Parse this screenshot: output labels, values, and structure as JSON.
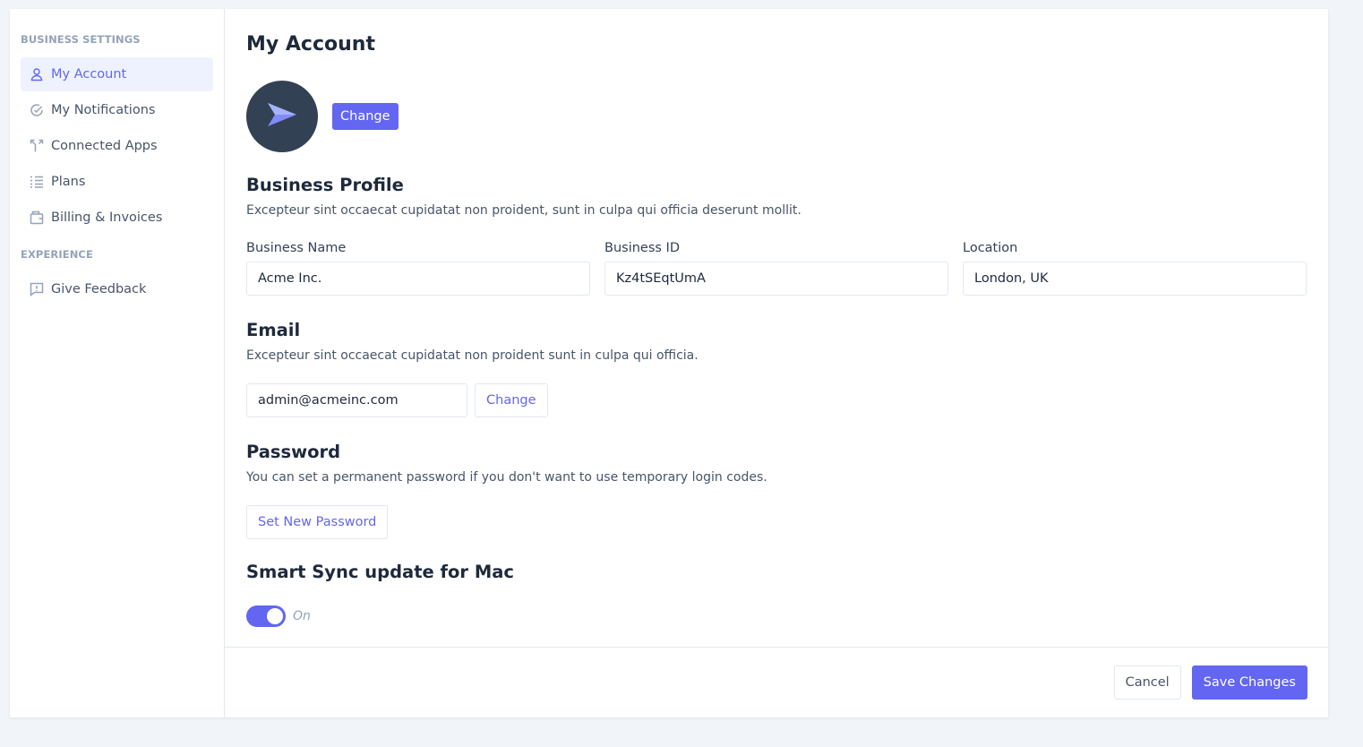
{
  "colors": {
    "accent": "#6366f1",
    "accent_bg": "#eef2ff",
    "avatar_bg": "#334155",
    "text_dark": "#1e293b",
    "text_muted": "#475569",
    "group_label": "#94a3b8",
    "border": "#e2e8f0",
    "page_bg": "#f1f5f9"
  },
  "sidebar": {
    "groups": [
      {
        "label": "Business Settings",
        "items": [
          {
            "label": "My Account",
            "icon": "user-icon",
            "active": true
          },
          {
            "label": "My Notifications",
            "icon": "check-circle-icon",
            "active": false
          },
          {
            "label": "Connected Apps",
            "icon": "connect-arrows-icon",
            "active": false
          },
          {
            "label": "Plans",
            "icon": "list-icon",
            "active": false
          },
          {
            "label": "Billing & Invoices",
            "icon": "wallet-icon",
            "active": false
          }
        ]
      },
      {
        "label": "Experience",
        "items": [
          {
            "label": "Give Feedback",
            "icon": "feedback-icon",
            "active": false
          }
        ]
      }
    ]
  },
  "main": {
    "title": "My Account",
    "avatar": {
      "icon": "paper-plane-icon",
      "change_label": "Change"
    },
    "business_profile": {
      "title": "Business Profile",
      "description": "Excepteur sint occaecat cupidatat non proident, sunt in culpa qui officia deserunt mollit.",
      "fields": [
        {
          "label": "Business Name",
          "value": "Acme Inc."
        },
        {
          "label": "Business ID",
          "value": "Kz4tSEqtUmA"
        },
        {
          "label": "Location",
          "value": "London, UK"
        }
      ]
    },
    "email": {
      "title": "Email",
      "description": "Excepteur sint occaecat cupidatat non proident sunt in culpa qui officia.",
      "value": "admin@acmeinc.com",
      "change_label": "Change"
    },
    "password": {
      "title": "Password",
      "description": "You can set a permanent password if you don't want to use temporary login codes.",
      "button_label": "Set New Password"
    },
    "smart_sync": {
      "title": "Smart Sync update for Mac",
      "enabled": true,
      "state_label": "On"
    }
  },
  "footer": {
    "cancel_label": "Cancel",
    "save_label": "Save Changes"
  }
}
